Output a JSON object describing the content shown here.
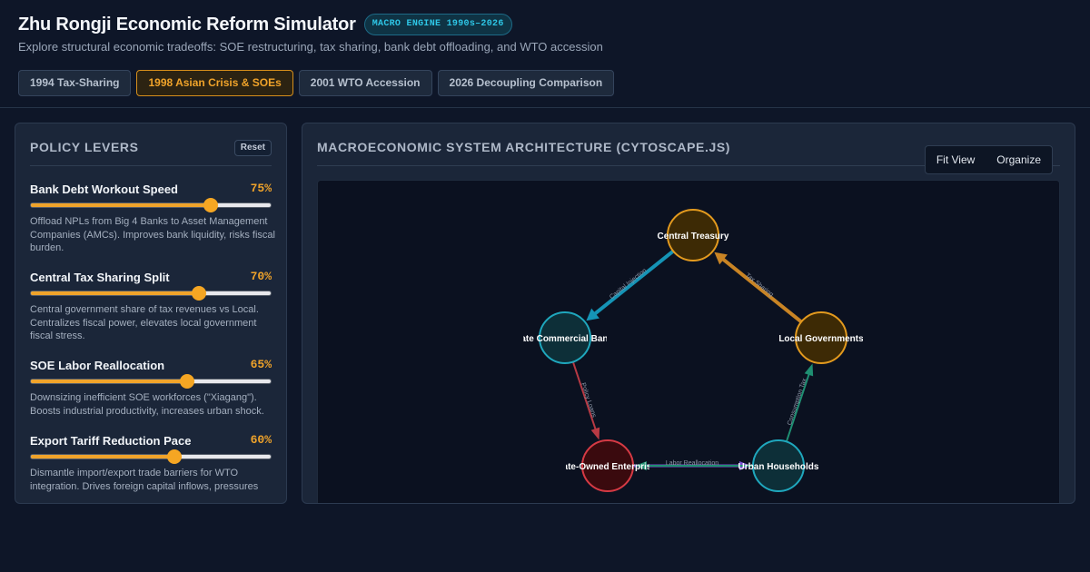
{
  "header": {
    "title": "Zhu Rongji Economic Reform Simulator",
    "badge": "MACRO ENGINE 1990s–2026",
    "subtitle": "Explore structural economic tradeoffs: SOE restructuring, tax sharing, bank debt offloading, and WTO accession"
  },
  "tabs": [
    {
      "label": "1994 Tax-Sharing",
      "active": false
    },
    {
      "label": "1998 Asian Crisis & SOEs",
      "active": true
    },
    {
      "label": "2001 WTO Accession",
      "active": false
    },
    {
      "label": "2026 Decoupling Comparison",
      "active": false
    }
  ],
  "levers_panel": {
    "title": "POLICY LEVERS",
    "reset_label": "Reset",
    "levers": [
      {
        "name": "Bank Debt Workout Speed",
        "value_label": "75%",
        "value": 75,
        "description": "Offload NPLs from Big 4 Banks to Asset Management Companies (AMCs). Improves bank liquidity, risks fiscal burden."
      },
      {
        "name": "Central Tax Sharing Split",
        "value_label": "70%",
        "value": 70,
        "description": "Central government share of tax revenues vs Local. Centralizes fiscal power, elevates local government fiscal stress."
      },
      {
        "name": "SOE Labor Reallocation",
        "value_label": "65%",
        "value": 65,
        "description": "Downsizing inefficient SOE workforces (\"Xiagang\"). Boosts industrial productivity, increases urban shock."
      },
      {
        "name": "Export Tariff Reduction Pace",
        "value_label": "60%",
        "value": 60,
        "description": "Dismantle import/export trade barriers for WTO integration. Drives foreign capital inflows, pressures"
      }
    ]
  },
  "graph_panel": {
    "title": "MACROECONOMIC SYSTEM ARCHITECTURE (CYTOSCAPE.JS)",
    "fit_label": "Fit View",
    "organize_label": "Organize",
    "nodes": [
      {
        "id": "treasury",
        "label": "Central Treasury",
        "fill": "#3d2a05",
        "stroke": "#e39a1e"
      },
      {
        "id": "banks",
        "label": "State Commercial Banks",
        "fill": "#0d2f38",
        "stroke": "#1fa7bd"
      },
      {
        "id": "localgov",
        "label": "Local Governments",
        "fill": "#3d2a05",
        "stroke": "#e39a1e"
      },
      {
        "id": "soe",
        "label": "State-Owned Enterprises",
        "fill": "#3a0a0e",
        "stroke": "#d63a44"
      },
      {
        "id": "households",
        "label": "Urban Households",
        "fill": "#0d2f38",
        "stroke": "#1fa7bd"
      }
    ],
    "edges": [
      {
        "from": "treasury",
        "to": "banks",
        "label": "Capital Injection",
        "color": "#1594b6"
      },
      {
        "from": "localgov",
        "to": "treasury",
        "label": "Tax Sharing",
        "color": "#c98424"
      },
      {
        "from": "banks",
        "to": "soe",
        "label": "Policy Loans",
        "color": "#b83a44"
      },
      {
        "from": "soe",
        "to": "households",
        "label": "Labor Reallocation",
        "color": "#7c4fd0"
      },
      {
        "from": "households",
        "to": "localgov",
        "label": "Consumption Tax",
        "color": "#1f8f72"
      },
      {
        "from": "households",
        "to": "soe",
        "label": "",
        "color": "#1f8f72"
      }
    ]
  }
}
